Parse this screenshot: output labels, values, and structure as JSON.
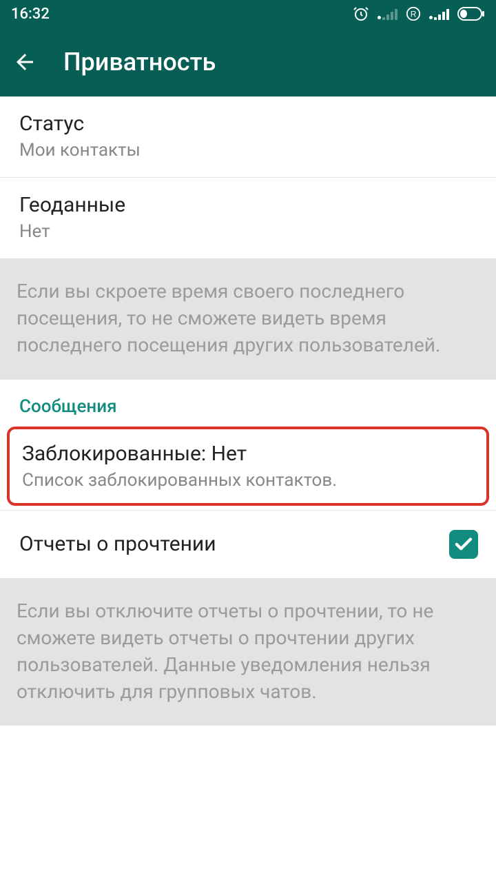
{
  "status": {
    "time": "16:32"
  },
  "header": {
    "title": "Приватность"
  },
  "items": {
    "status": {
      "title": "Статус",
      "value": "Мои контакты"
    },
    "geo": {
      "title": "Геоданные",
      "value": "Нет"
    }
  },
  "info1": "Если вы скроете время своего последнего посещения, то не сможете видеть время последнего посещения других пользователей.",
  "section_messages": "Сообщения",
  "blocked": {
    "title": "Заблокированные: Нет",
    "sub": "Список заблокированных контактов."
  },
  "read_receipts": {
    "label": "Отчеты о прочтении",
    "checked": true
  },
  "info2": "Если вы отключите отчеты о прочтении, то не сможете видеть отчеты о прочтении других пользователей. Данные уведомления нельзя отключить для групповых чатов."
}
